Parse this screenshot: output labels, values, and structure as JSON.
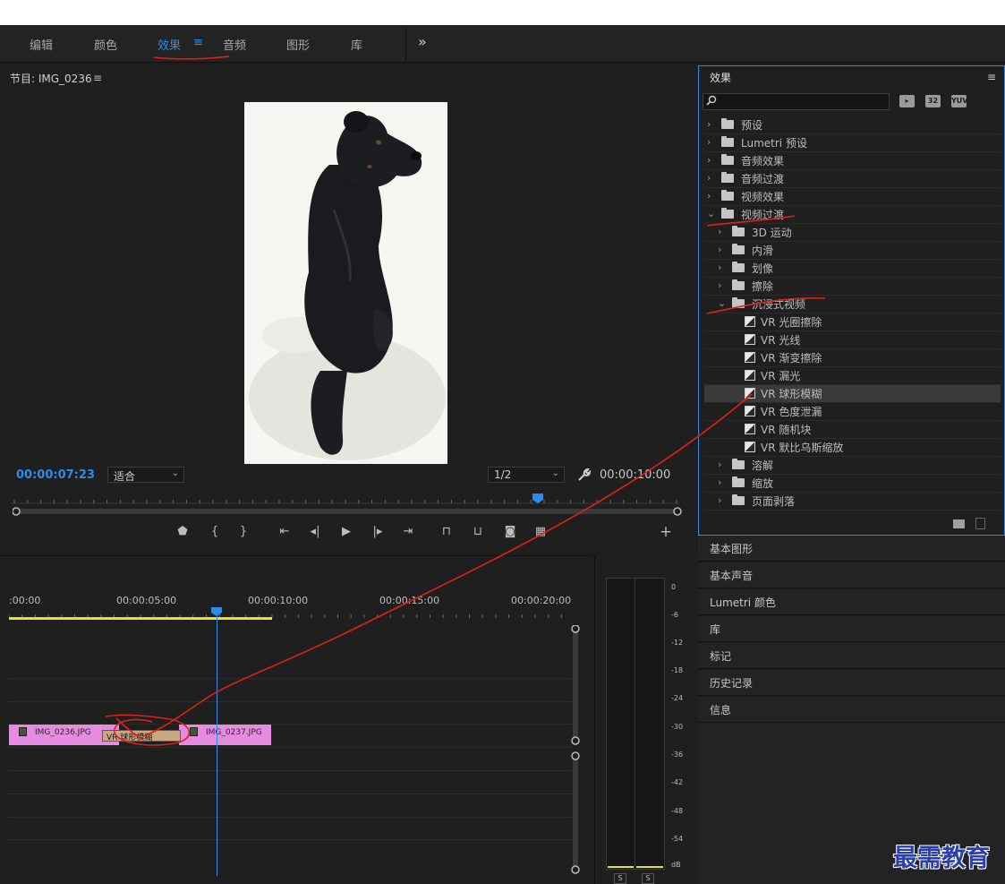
{
  "workspace": {
    "tabs": [
      "编辑",
      "颜色",
      "效果",
      "音频",
      "图形",
      "库"
    ],
    "active": "效果",
    "active_menu": "≡",
    "overflow": "»"
  },
  "program_monitor": {
    "title": "节目: IMG_0236",
    "menu": "≡",
    "timecode_current": "00:00:07:23",
    "fit_value": "适合",
    "resolution_value": "1/2",
    "timecode_duration": "00:00:10:00"
  },
  "timeline": {
    "ruler_labels": [
      ":00:00",
      "00:00:05:00",
      "00:00:10:00",
      "00:00:15:00",
      "00:00:20:00"
    ],
    "clips": [
      {
        "name": "IMG_0236.JPG"
      },
      {
        "name": "IMG_0237.JPG"
      }
    ],
    "transition_prefix": "VR",
    "transition_name": "球形模糊"
  },
  "audio_meter": {
    "scale": [
      "0",
      "-6",
      "-12",
      "-18",
      "-24",
      "-30",
      "-36",
      "-42",
      "-48",
      "-54",
      "dB"
    ],
    "solo_left": "S",
    "solo_right": "S"
  },
  "effects_panel": {
    "title": "效果",
    "menu": "≡",
    "filters": [
      "▸",
      "32",
      "YUV"
    ],
    "tree": [
      {
        "label": "预设",
        "level": 0,
        "expanded": false,
        "kind": "preset-folder"
      },
      {
        "label": "Lumetri 预设",
        "level": 0,
        "expanded": false,
        "kind": "preset-folder"
      },
      {
        "label": "音频效果",
        "level": 0,
        "expanded": false,
        "kind": "folder"
      },
      {
        "label": "音频过渡",
        "level": 0,
        "expanded": false,
        "kind": "folder"
      },
      {
        "label": "视频效果",
        "level": 0,
        "expanded": false,
        "kind": "folder"
      },
      {
        "label": "视频过渡",
        "level": 0,
        "expanded": true,
        "kind": "folder"
      },
      {
        "label": "3D 运动",
        "level": 1,
        "expanded": false,
        "kind": "folder"
      },
      {
        "label": "内滑",
        "level": 1,
        "expanded": false,
        "kind": "folder"
      },
      {
        "label": "划像",
        "level": 1,
        "expanded": false,
        "kind": "folder"
      },
      {
        "label": "擦除",
        "level": 1,
        "expanded": false,
        "kind": "folder"
      },
      {
        "label": "沉浸式视频",
        "level": 1,
        "expanded": true,
        "kind": "folder"
      },
      {
        "label": "VR 光圈擦除",
        "level": 2,
        "kind": "effect"
      },
      {
        "label": "VR 光线",
        "level": 2,
        "kind": "effect"
      },
      {
        "label": "VR 渐变擦除",
        "level": 2,
        "kind": "effect"
      },
      {
        "label": "VR 漏光",
        "level": 2,
        "kind": "effect"
      },
      {
        "label": "VR 球形模糊",
        "level": 2,
        "kind": "effect",
        "selected": true
      },
      {
        "label": "VR 色度泄漏",
        "level": 2,
        "kind": "effect"
      },
      {
        "label": "VR 随机块",
        "level": 2,
        "kind": "effect"
      },
      {
        "label": "VR 默比乌斯缩放",
        "level": 2,
        "kind": "effect"
      },
      {
        "label": "溶解",
        "level": 1,
        "expanded": false,
        "kind": "folder"
      },
      {
        "label": "缩放",
        "level": 1,
        "expanded": false,
        "kind": "folder"
      },
      {
        "label": "页面剥落",
        "level": 1,
        "expanded": false,
        "kind": "folder"
      }
    ]
  },
  "side_panels": [
    "基本图形",
    "基本声音",
    "Lumetri 颜色",
    "库",
    "标记",
    "历史记录",
    "信息"
  ],
  "watermark": "最需教育",
  "colors": {
    "accent": "#2d8ceb",
    "clip": "#e58be0",
    "annotation": "#e0201a",
    "work_area": "#e6e227"
  }
}
